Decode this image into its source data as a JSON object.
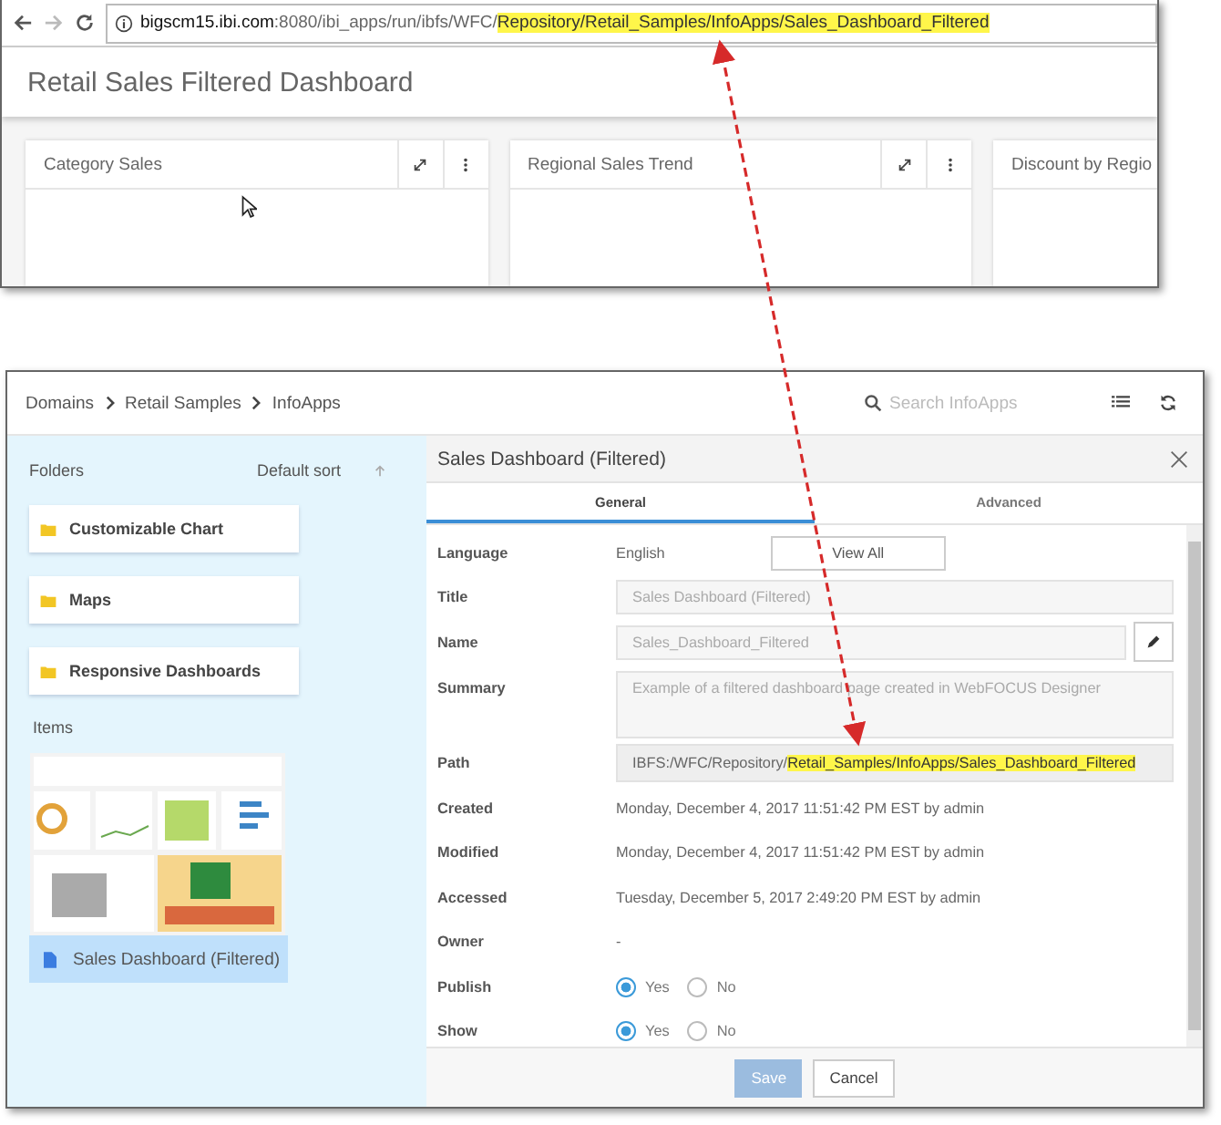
{
  "browser": {
    "url_segments": [
      {
        "text": "bigscm15.ibi.com",
        "kind": "host"
      },
      {
        "text": ":8080/ibi_apps/run/ibfs/WFC/",
        "kind": "plain"
      },
      {
        "text": "Repository/Retail_Samples/InfoApps/Sales_Dashboard_Filtered",
        "kind": "highlight"
      }
    ],
    "page_title": "Retail Sales Filtered Dashboard",
    "panels": [
      {
        "title": "Category Sales",
        "tools": true
      },
      {
        "title": "Regional Sales Trend",
        "tools": true
      },
      {
        "title": "Discount by Regio",
        "tools": false
      }
    ]
  },
  "hub": {
    "breadcrumbs": [
      "Domains",
      "Retail Samples",
      "InfoApps"
    ],
    "search": {
      "placeholder": "Search InfoApps"
    },
    "sidebar": {
      "folders_label": "Folders",
      "sort_label": "Default sort",
      "folders": [
        "Customizable Chart",
        "Maps",
        "Responsive Dashboards"
      ],
      "items_label": "Items",
      "items": [
        {
          "name": "Sales Dashboard (Filtered)",
          "selected": true
        }
      ]
    },
    "details": {
      "title": "Sales Dashboard (Filtered)",
      "tabs": [
        {
          "label": "General",
          "selected": true
        },
        {
          "label": "Advanced",
          "selected": false
        }
      ],
      "fields": [
        {
          "label": "Language",
          "kind": "text",
          "value": "English",
          "button": "View All"
        },
        {
          "label": "Title",
          "kind": "input",
          "value": "Sales Dashboard (Filtered)"
        },
        {
          "label": "Name",
          "kind": "input_edit",
          "value": "Sales_Dashboard_Filtered"
        },
        {
          "label": "Summary",
          "kind": "textarea",
          "value": "Example of a filtered dashboard page created in WebFOCUS Designer"
        },
        {
          "label": "Path",
          "kind": "path",
          "segments": [
            {
              "text": "IBFS:/WFC/Repository/",
              "highlighted": false
            },
            {
              "text": "Retail_Samples/InfoApps/Sales_Dashboard_Filtered",
              "highlighted": true
            }
          ]
        },
        {
          "label": "Created",
          "kind": "text",
          "value": "Monday, December 4, 2017 11:51:42 PM EST by admin"
        },
        {
          "label": "Modified",
          "kind": "text",
          "value": "Monday, December 4, 2017 11:51:42 PM EST by admin"
        },
        {
          "label": "Accessed",
          "kind": "text",
          "value": "Tuesday, December 5, 2017 2:49:20 PM EST by admin"
        },
        {
          "label": "Owner",
          "kind": "text",
          "value": "-"
        },
        {
          "label": "Publish",
          "kind": "radio",
          "options": [
            {
              "label": "Yes",
              "selected": true
            },
            {
              "label": "No",
              "selected": false
            }
          ]
        },
        {
          "label": "Show",
          "kind": "radio",
          "options": [
            {
              "label": "Yes",
              "selected": true
            },
            {
              "label": "No",
              "selected": false
            }
          ]
        }
      ],
      "buttons": [
        {
          "label": "Save",
          "kind": "primary",
          "disabled": true
        },
        {
          "label": "Cancel",
          "kind": "secondary",
          "disabled": false
        }
      ]
    }
  }
}
